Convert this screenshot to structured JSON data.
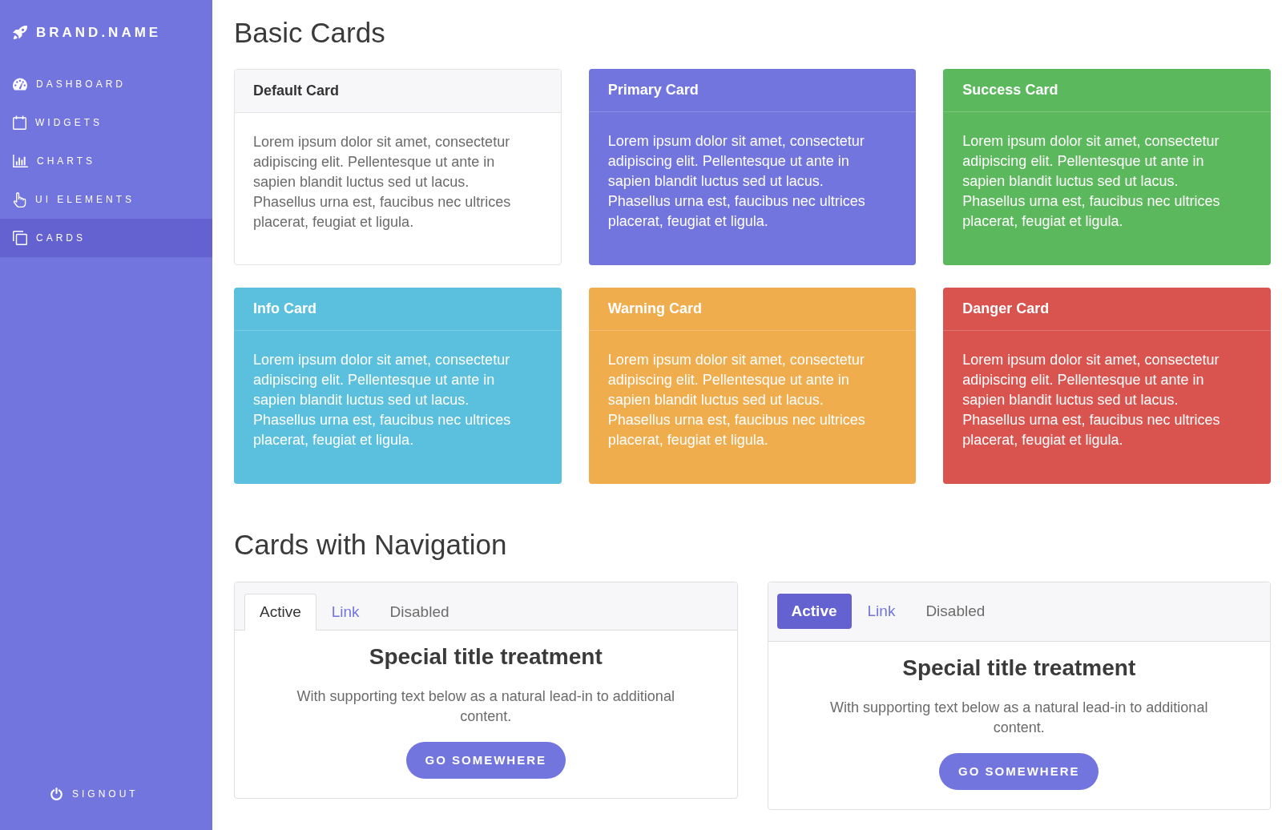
{
  "sidebar": {
    "brand": "BRAND.NAME",
    "items": [
      {
        "label": "DASHBOARD",
        "selected": false
      },
      {
        "label": "WIDGETS",
        "selected": false
      },
      {
        "label": "CHARTS",
        "selected": false
      },
      {
        "label": "UI ELEMENTS",
        "selected": false
      },
      {
        "label": "CARDS",
        "selected": true
      }
    ],
    "signout": "SIGNOUT"
  },
  "basic_cards": {
    "title": "Basic Cards",
    "cards": [
      {
        "kind": "default",
        "title": "Default Card",
        "text": "Lorem ipsum dolor sit amet, consectetur adipiscing elit. Pellentesque ut ante in sapien blandit luctus sed ut lacus. Phasellus urna est, faucibus nec ultrices placerat, feugiat et ligula."
      },
      {
        "kind": "filled",
        "color": "#7375de",
        "title": "Primary Card",
        "text": "Lorem ipsum dolor sit amet, consectetur adipiscing elit. Pellentesque ut ante in sapien blandit luctus sed ut lacus. Phasellus urna est, faucibus nec ultrices placerat, feugiat et ligula."
      },
      {
        "kind": "filled",
        "color": "#5cb85c",
        "title": "Success Card",
        "text": "Lorem ipsum dolor sit amet, consectetur adipiscing elit. Pellentesque ut ante in sapien blandit luctus sed ut lacus. Phasellus urna est, faucibus nec ultrices placerat, feugiat et ligula."
      },
      {
        "kind": "filled",
        "color": "#5bc0de",
        "title": "Info Card",
        "text": "Lorem ipsum dolor sit amet, consectetur adipiscing elit. Pellentesque ut ante in sapien blandit luctus sed ut lacus. Phasellus urna est, faucibus nec ultrices placerat, feugiat et ligula."
      },
      {
        "kind": "filled",
        "color": "#f0ad4e",
        "title": "Warning Card",
        "text": "Lorem ipsum dolor sit amet, consectetur adipiscing elit. Pellentesque ut ante in sapien blandit luctus sed ut lacus. Phasellus urna est, faucibus nec ultrices placerat, feugiat et ligula."
      },
      {
        "kind": "filled",
        "color": "#d9534f",
        "title": "Danger Card",
        "text": "Lorem ipsum dolor sit amet, consectetur adipiscing elit. Pellentesque ut ante in sapien blandit luctus sed ut lacus. Phasellus urna est, faucibus nec ultrices placerat, feugiat et ligula."
      }
    ]
  },
  "navigation_cards": {
    "title": "Cards with Navigation",
    "cards": [
      {
        "kind": "tabs",
        "tabs": [
          {
            "label": "Active",
            "selected": true,
            "disabled": false
          },
          {
            "label": "Link",
            "selected": false,
            "disabled": false
          },
          {
            "label": "Disabled",
            "selected": false,
            "disabled": true
          }
        ],
        "title": "Special title treatment",
        "text": "With supporting text below as a natural lead-in to additional content.",
        "button": "GO SOMEWHERE"
      },
      {
        "kind": "pills",
        "tabs": [
          {
            "label": "Active",
            "selected": true,
            "disabled": false
          },
          {
            "label": "Link",
            "selected": false,
            "disabled": false
          },
          {
            "label": "Disabled",
            "selected": false,
            "disabled": true
          }
        ],
        "title": "Special title treatment",
        "text": "With supporting text below as a natural lead-in to additional content.",
        "button": "GO SOMEWHERE"
      }
    ]
  }
}
